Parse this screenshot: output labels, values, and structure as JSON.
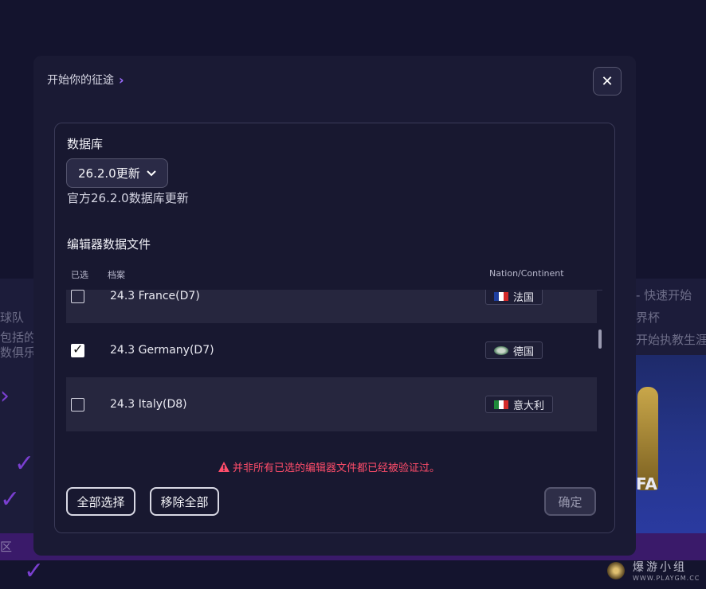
{
  "background": {
    "left_lines": [
      "球队",
      "包括的",
      "数俱乐"
    ],
    "right_lines": [
      "- 快速开始",
      "界杯",
      "开始执教生涯"
    ],
    "right_image_text": "FA",
    "bottom_left_label": "区",
    "watermark": {
      "title": "爆游小组",
      "url": "WWW.PLAYGM.CC"
    }
  },
  "modal": {
    "breadcrumb": "开始你的征途",
    "close_symbol": "✕",
    "database": {
      "title": "数据库",
      "selected": "26.2.0更新",
      "description": "官方26.2.0数据库更新"
    },
    "editor_files": {
      "title": "编辑器数据文件",
      "columns": {
        "selected": "已选",
        "file": "档案",
        "nation": "Nation/Continent"
      },
      "rows": [
        {
          "name": "24.3 France(D7)",
          "nation": "法国",
          "flag": "france-flag",
          "checked": false
        },
        {
          "name": "24.3 Germany(D7)",
          "nation": "德国",
          "flag": "germany-flag",
          "checked": true
        },
        {
          "name": "24.3 Italy(D8)",
          "nation": "意大利",
          "flag": "italy-flag",
          "checked": false
        }
      ]
    },
    "warning": "并非所有已选的编辑器文件都已经被验证过。",
    "buttons": {
      "select_all": "全部选择",
      "remove_all": "移除全部",
      "confirm": "确定"
    }
  },
  "colors": {
    "accent": "#9b6cff",
    "warning": "#ff4d6a",
    "modal_bg": "#1a1a34"
  }
}
